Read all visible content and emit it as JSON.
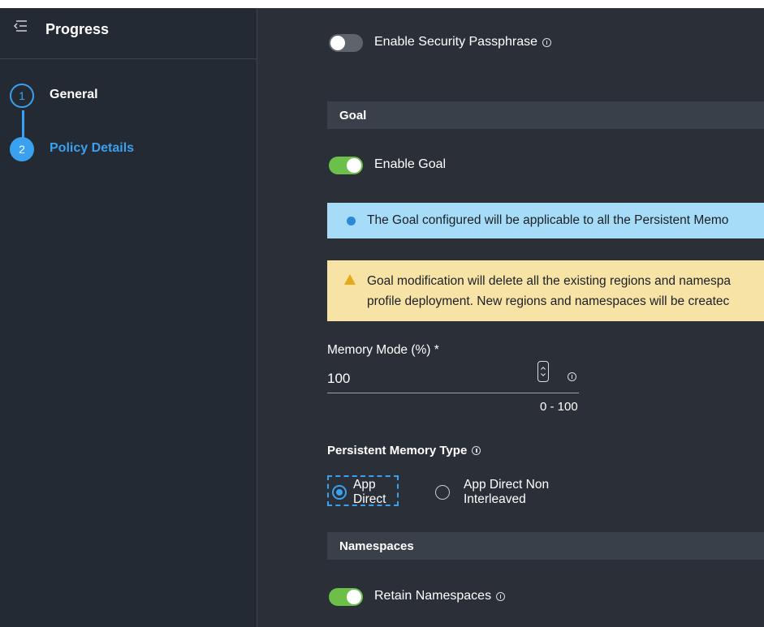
{
  "sidebar": {
    "title": "Progress",
    "steps": [
      {
        "number": "1",
        "label": "General",
        "state": "completed"
      },
      {
        "number": "2",
        "label": "Policy Details",
        "state": "active"
      }
    ]
  },
  "main": {
    "security_passphrase": {
      "label": "Enable Security Passphrase",
      "enabled": false
    },
    "goal_section": {
      "title": "Goal",
      "enable_goal": {
        "label": "Enable Goal",
        "enabled": true
      },
      "info_message": "The Goal configured will be applicable to all the Persistent Memo",
      "warning_line1": "Goal modification will delete all the existing regions and namespa",
      "warning_line2": "profile deployment. New regions and namespaces will be createc",
      "memory_mode": {
        "label": "Memory Mode (%) *",
        "value": "100",
        "range": "0 - 100"
      },
      "persistent_memory_type": {
        "label": "Persistent Memory Type",
        "options": [
          {
            "label": "App Direct",
            "selected": true
          },
          {
            "label": "App Direct Non Interleaved",
            "selected": false
          }
        ]
      }
    },
    "namespaces_section": {
      "title": "Namespaces",
      "retain_namespaces": {
        "label": "Retain Namespaces",
        "enabled": true
      }
    }
  },
  "colors": {
    "background": "#2b3038",
    "sidebar": "#242a33",
    "accent_blue": "#3aa0f0",
    "toggle_on": "#6cc04a",
    "info_bg": "#a6dcf8",
    "warn_bg": "#f8e3a7"
  }
}
